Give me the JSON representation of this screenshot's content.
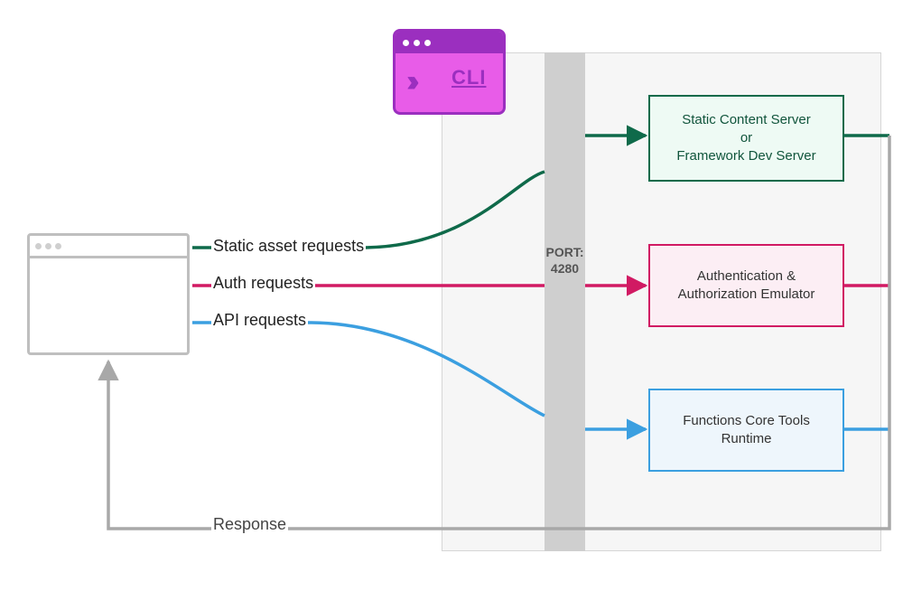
{
  "cli": {
    "label": "CLI"
  },
  "port": {
    "title": "PORT:",
    "number": "4280"
  },
  "client": {
    "type": "browser-window"
  },
  "flows": {
    "static_label": "Static asset requests",
    "auth_label": "Auth requests",
    "api_label": "API requests",
    "response_label": "Response"
  },
  "services": {
    "static_content": "Static Content Server\nor\nFramework Dev Server",
    "auth_emulator": "Authentication & Authorization Emulator",
    "functions": "Functions Core Tools Runtime"
  },
  "colors": {
    "static": "#0f6a4a",
    "auth": "#d11a63",
    "api": "#3b9fe0",
    "response": "#a8a8a8",
    "cli_border": "#9b2fbf",
    "cli_body": "#e85ce8"
  }
}
